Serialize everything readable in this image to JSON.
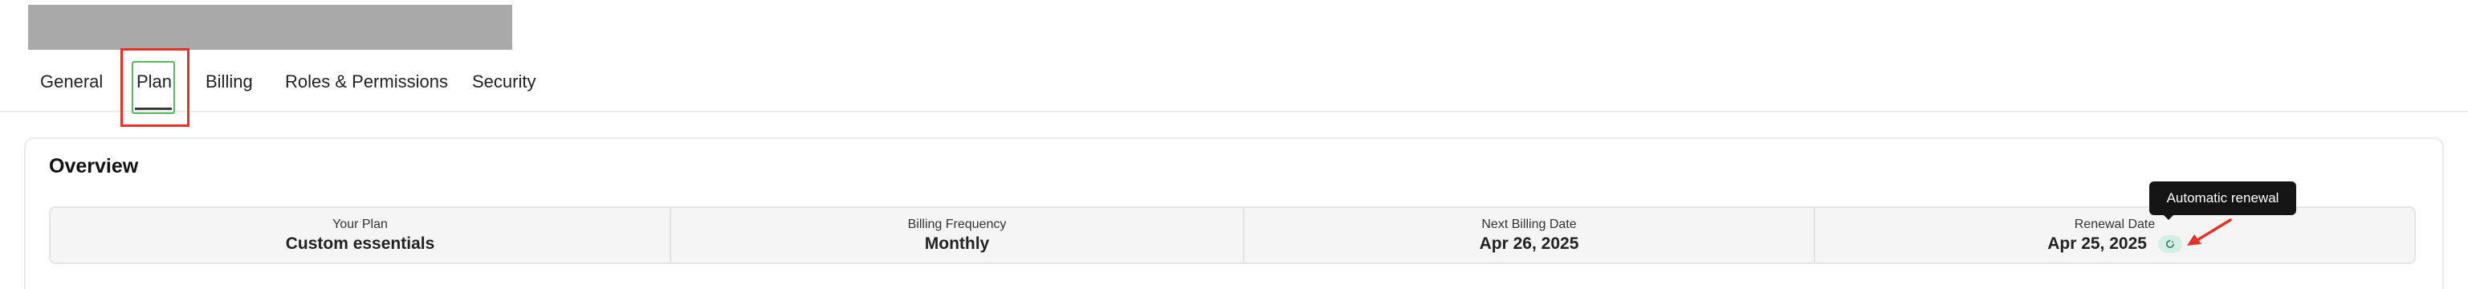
{
  "header": {
    "redacted_title": ""
  },
  "tabs": [
    {
      "label": "General",
      "active": false
    },
    {
      "label": "Plan",
      "active": true
    },
    {
      "label": "Billing",
      "active": false
    },
    {
      "label": "Roles & Permissions",
      "active": false
    },
    {
      "label": "Security",
      "active": false
    }
  ],
  "overview": {
    "title": "Overview",
    "stats": {
      "plan": {
        "label": "Your Plan",
        "value": "Custom essentials"
      },
      "billing_frequency": {
        "label": "Billing Frequency",
        "value": "Monthly"
      },
      "next_billing_date": {
        "label": "Next Billing Date",
        "value": "Apr 26, 2025"
      },
      "renewal_date": {
        "label": "Renewal Date",
        "value": "Apr 25, 2025",
        "icon": "automatic-renewal-icon"
      }
    }
  },
  "tooltip": {
    "text": "Automatic renewal"
  },
  "colors": {
    "highlight_red": "#e53228",
    "active_tab_outline": "#55b95b",
    "renewal_badge": "#d4efe6",
    "tooltip_bg": "#141414"
  }
}
